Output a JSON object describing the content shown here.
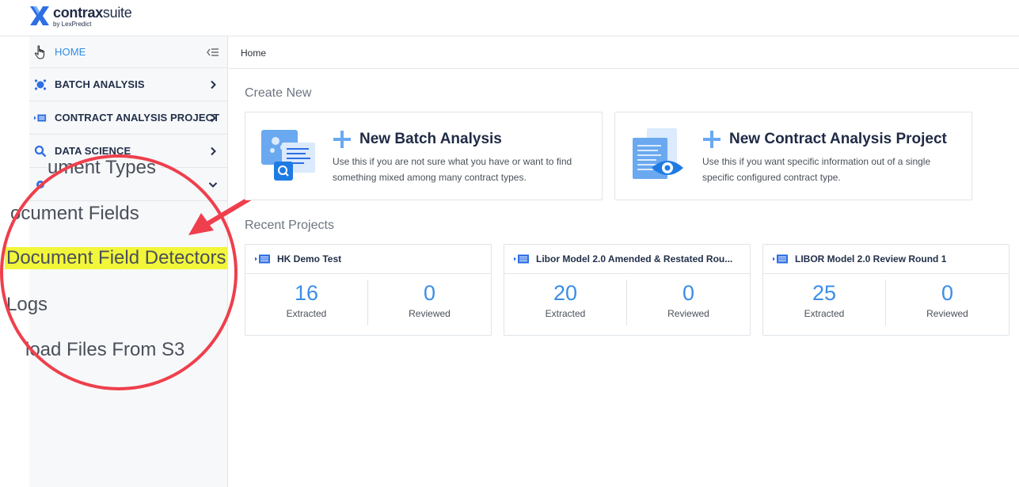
{
  "app": {
    "logo_name_bold": "contrax",
    "logo_name_light": "suite",
    "logo_sub": "by LexPredict"
  },
  "sidebar": {
    "items": [
      {
        "label": "HOME",
        "icon": "home-icon"
      },
      {
        "label": "BATCH ANALYSIS",
        "icon": "batch-analysis-icon"
      },
      {
        "label": "CONTRACT ANALYSIS PROJECT",
        "icon": "contract-project-icon"
      },
      {
        "label": "DATA SCIENCE",
        "icon": "search-icon"
      },
      {
        "label": "",
        "icon": "gear-icon"
      }
    ]
  },
  "zoom_overlay": {
    "items": [
      "ument Types",
      "ocument Fields",
      "Document Field Detectors",
      "Logs",
      "load Files From S3"
    ],
    "highlight_color": "#f2f63a",
    "circle_color": "#ef3f4c"
  },
  "breadcrumb": "Home",
  "create_new": {
    "title": "Create New",
    "cards": [
      {
        "title": "New Batch Analysis",
        "desc": "Use this if you are not sure what you have or want to find something mixed among many contract types."
      },
      {
        "title": "New Contract Analysis Project",
        "desc": "Use this if you want specific information out of a single specific configured contract type."
      }
    ]
  },
  "recent_projects": {
    "title": "Recent Projects",
    "projects": [
      {
        "name": "HK Demo Test",
        "extracted": "16",
        "extracted_label": "Extracted",
        "reviewed": "0",
        "reviewed_label": "Reviewed"
      },
      {
        "name": "Libor Model 2.0 Amended & Restated Rou...",
        "extracted": "20",
        "extracted_label": "Extracted",
        "reviewed": "0",
        "reviewed_label": "Reviewed"
      },
      {
        "name": "LIBOR Model 2.0 Review Round 1",
        "extracted": "25",
        "extracted_label": "Extracted",
        "reviewed": "0",
        "reviewed_label": "Reviewed"
      }
    ]
  },
  "colors": {
    "accent": "#2f8be6",
    "stat_number": "#3a8ee6",
    "brand_dark": "#1f2a44"
  }
}
